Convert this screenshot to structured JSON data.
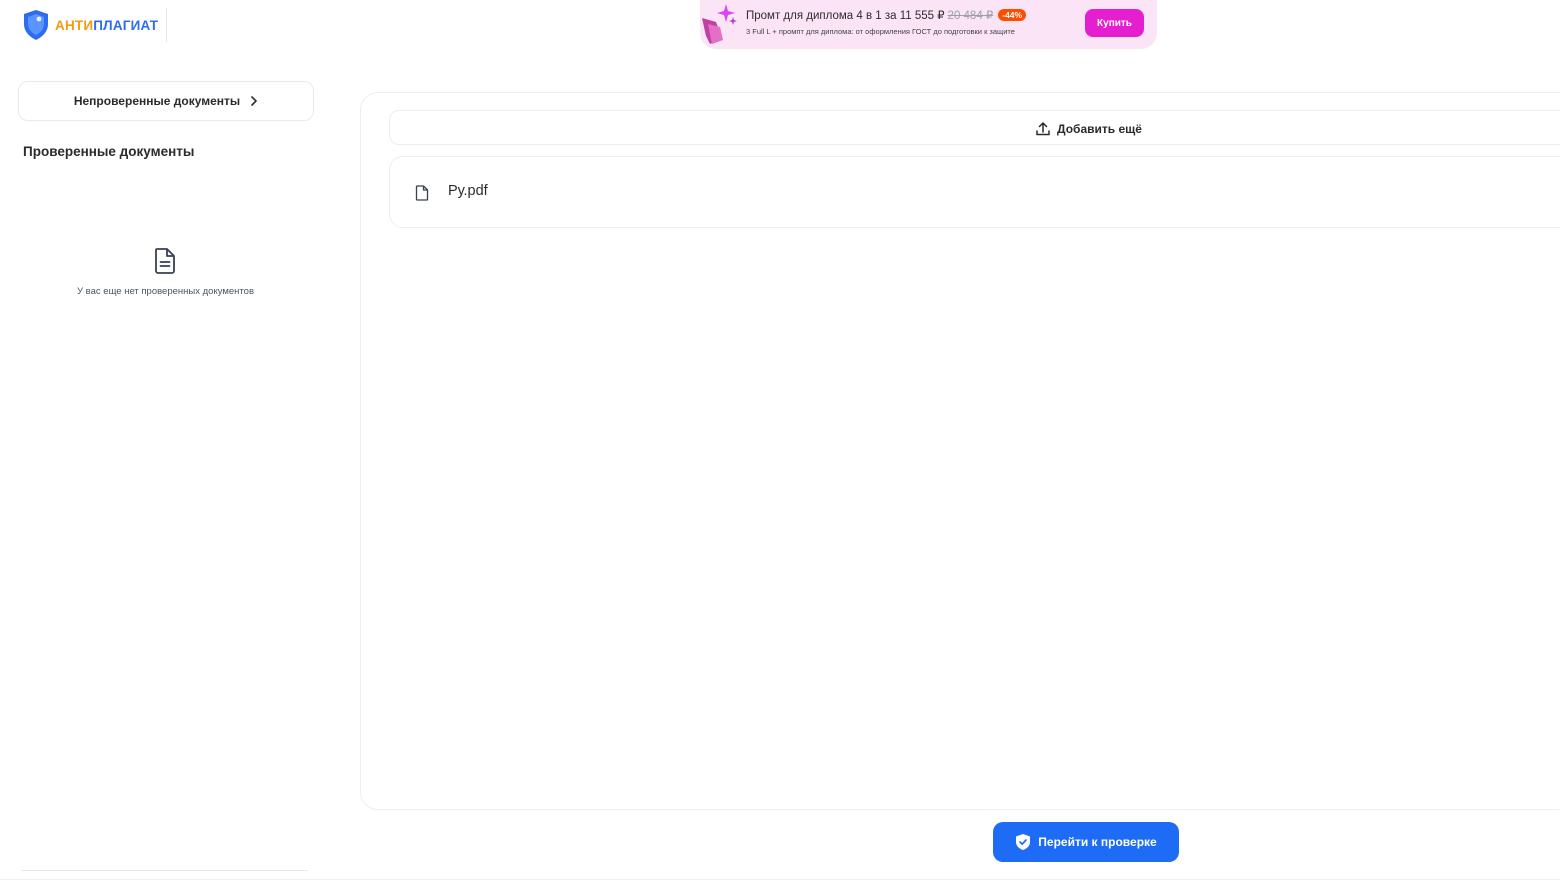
{
  "header": {
    "logo": {
      "part1": "АНТИ",
      "part2": "ПЛАГИАТ",
      "icon": "shield-icon",
      "colors": {
        "part1": "#f39c12",
        "part2": "#2b6cf0",
        "shield": "#2b6cf0"
      }
    },
    "promo": {
      "title": "Промт для диплома 4 в 1 за 11 555 ₽",
      "old_price": "20 484 ₽",
      "discount": "-44%",
      "subtitle": "3 Full L + промпт для диплома: от оформления ГОСТ до подготовки к защите",
      "buy_label": "Купить",
      "colors": {
        "background": "#fbe4f6",
        "button": "#e51fcf",
        "badge": "#ff4d00"
      }
    }
  },
  "sidebar": {
    "unverified_label": "Непроверенные документы",
    "verified_title": "Проверенные документы",
    "empty_icon": "document-icon",
    "empty_text": "У вас еще нет проверенных документов"
  },
  "main": {
    "add_more_label": "Добавить ещё",
    "add_icon": "upload-icon",
    "files": [
      {
        "name": "Ру.pdf",
        "icon": "file-icon"
      }
    ]
  },
  "footer": {
    "go_check_label": "Перейти к проверке",
    "go_check_icon": "shield-check-icon",
    "accent": "#1e6bf5"
  }
}
